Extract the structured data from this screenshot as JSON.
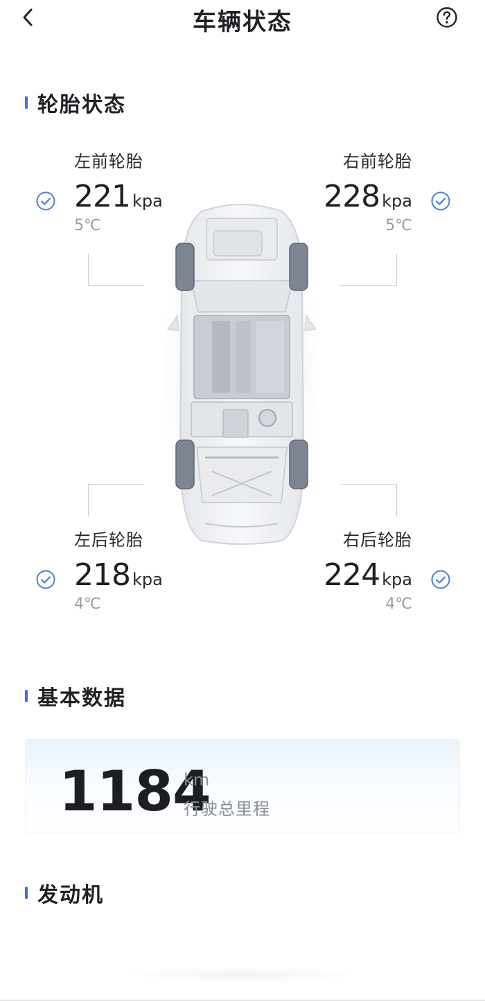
{
  "header": {
    "title": "车辆状态",
    "back_icon": "chevron-left-icon",
    "help_icon": "question-circle-icon"
  },
  "sections": {
    "tires": "轮胎状态",
    "basic": "基本数据",
    "engine": "发动机"
  },
  "tires": {
    "front_left": {
      "label": "左前轮胎",
      "pressure": "221",
      "unit": "kpa",
      "temp": "5℃",
      "status_icon": "check-circle-icon"
    },
    "front_right": {
      "label": "右前轮胎",
      "pressure": "228",
      "unit": "kpa",
      "temp": "5℃",
      "status_icon": "check-circle-icon"
    },
    "rear_left": {
      "label": "左后轮胎",
      "pressure": "218",
      "unit": "kpa",
      "temp": "4℃",
      "status_icon": "check-circle-icon"
    },
    "rear_right": {
      "label": "右后轮胎",
      "pressure": "224",
      "unit": "kpa",
      "temp": "4℃",
      "status_icon": "check-circle-icon"
    }
  },
  "mileage": {
    "value": "1184",
    "unit": "km",
    "label": "行驶总里程"
  },
  "colors": {
    "accent": "#3f6fd6",
    "check": "#4a7fd0",
    "muted": "#9a9ca2"
  }
}
